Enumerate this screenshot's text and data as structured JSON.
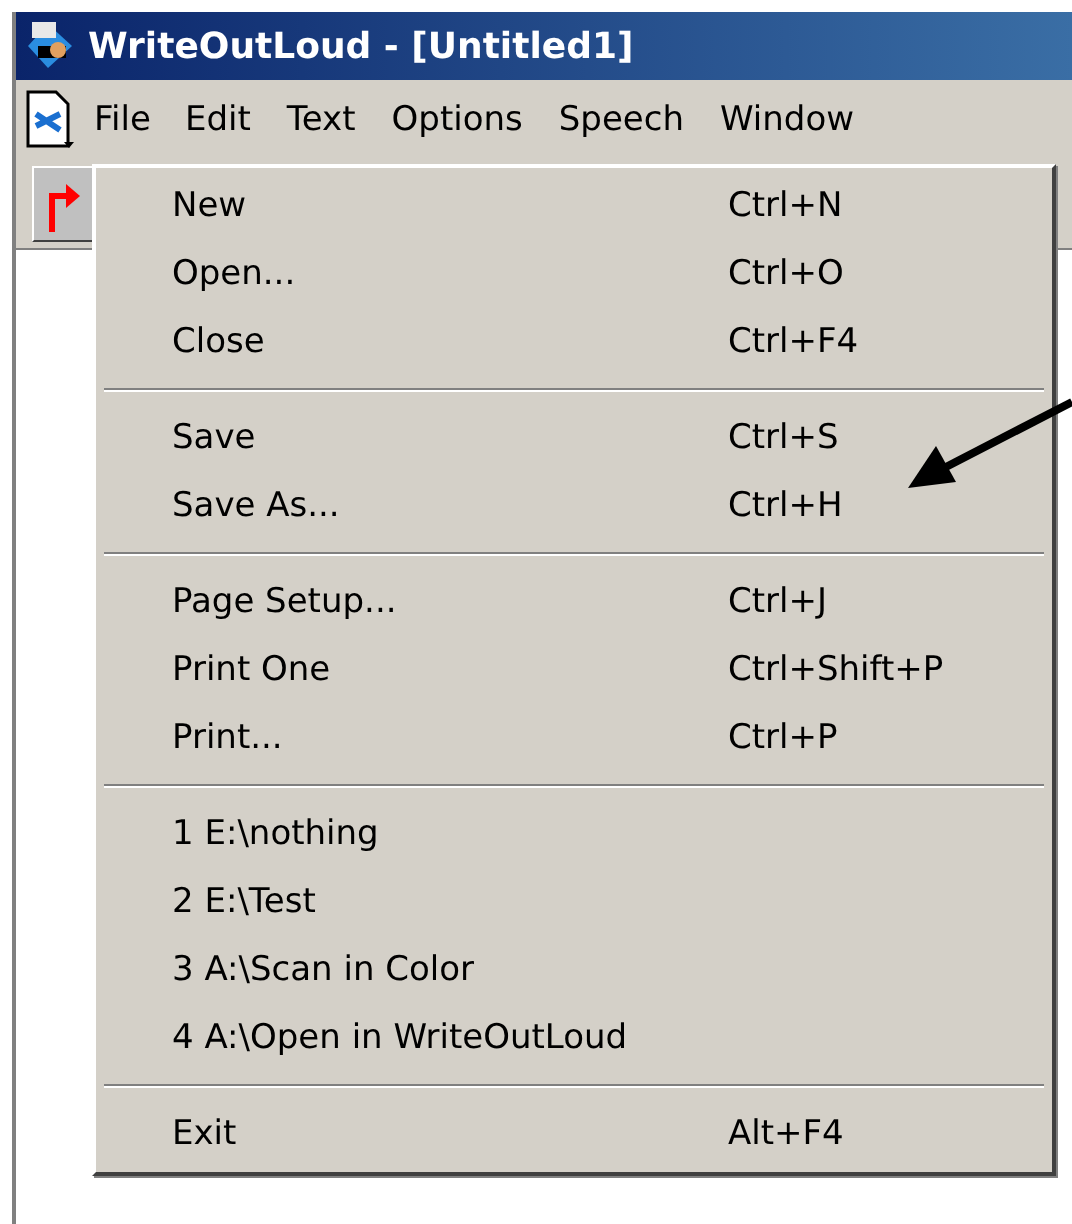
{
  "window": {
    "title": "WriteOutLoud - [Untitled1]"
  },
  "menu_bar": [
    {
      "label": "File",
      "selected": true
    },
    {
      "label": "Edit",
      "selected": false
    },
    {
      "label": "Text",
      "selected": false
    },
    {
      "label": "Options",
      "selected": false
    },
    {
      "label": "Speech",
      "selected": false
    },
    {
      "label": "Window",
      "selected": false
    }
  ],
  "file_menu": [
    [
      {
        "label": "New",
        "shortcut": "Ctrl+N"
      },
      {
        "label": "Open...",
        "shortcut": "Ctrl+O"
      },
      {
        "label": "Close",
        "shortcut": "Ctrl+F4"
      }
    ],
    [
      {
        "label": "Save",
        "shortcut": "Ctrl+S"
      },
      {
        "label": "Save As...",
        "shortcut": "Ctrl+H"
      }
    ],
    [
      {
        "label": "Page Setup...",
        "shortcut": "Ctrl+J"
      },
      {
        "label": "Print One",
        "shortcut": "Ctrl+Shift+P"
      },
      {
        "label": "Print...",
        "shortcut": "Ctrl+P"
      }
    ],
    [
      {
        "label": "1 E:\\nothing"
      },
      {
        "label": "2 E:\\Test"
      },
      {
        "label": "3 A:\\Scan in Color"
      },
      {
        "label": "4 A:\\Open in WriteOutLoud"
      }
    ],
    [
      {
        "label": "Exit",
        "shortcut": "Alt+F4"
      }
    ]
  ]
}
